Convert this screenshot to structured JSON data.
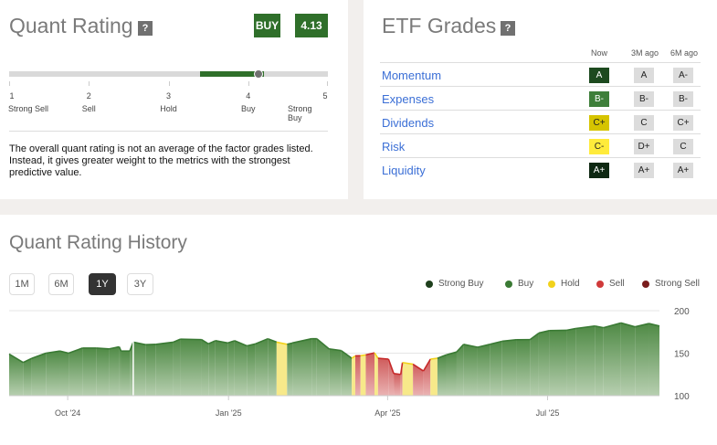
{
  "quant_rating": {
    "title": "Quant Rating",
    "help": "?",
    "rating_label": "BUY",
    "score": "4.13",
    "score_value": 4.13,
    "scale": [
      {
        "num": "1",
        "label": "Strong Sell"
      },
      {
        "num": "2",
        "label": "Sell"
      },
      {
        "num": "3",
        "label": "Hold"
      },
      {
        "num": "4",
        "label": "Buy"
      },
      {
        "num": "5",
        "label": "Strong Buy"
      }
    ],
    "description": "The overall quant rating is not an average of the factor grades listed. Instead, it gives greater weight to the metrics with the strongest predictive value.",
    "accent": "#2f6f2a"
  },
  "etf_grades": {
    "title": "ETF Grades",
    "help": "?",
    "columns": [
      "Now",
      "3M ago",
      "6M ago"
    ],
    "rows": [
      {
        "name": "Momentum",
        "now": "A",
        "m3": "A",
        "m6": "A-",
        "color": "#1d4a1f",
        "text": "#fff"
      },
      {
        "name": "Expenses",
        "now": "B-",
        "m3": "B-",
        "m6": "B-",
        "color": "#3e7f3a",
        "text": "#fff"
      },
      {
        "name": "Dividends",
        "now": "C+",
        "m3": "C",
        "m6": "C+",
        "color": "#d6c400",
        "text": "#222"
      },
      {
        "name": "Risk",
        "now": "C-",
        "m3": "D+",
        "m6": "C",
        "color": "#ffeb3b",
        "text": "#222"
      },
      {
        "name": "Liquidity",
        "now": "A+",
        "m3": "A+",
        "m6": "A+",
        "color": "#0e2812",
        "text": "#fff"
      }
    ]
  },
  "history": {
    "title": "Quant Rating History",
    "ranges": [
      "1M",
      "6M",
      "1Y",
      "3Y"
    ],
    "active_range": "1Y",
    "legend": [
      {
        "label": "Strong Buy",
        "color": "#1e3f1c"
      },
      {
        "label": "Buy",
        "color": "#3a7a34"
      },
      {
        "label": "Hold",
        "color": "#f2d21b"
      },
      {
        "label": "Sell",
        "color": "#d03a3a"
      },
      {
        "label": "Strong Sell",
        "color": "#7a1d1d"
      }
    ]
  },
  "chart_data": {
    "type": "area",
    "xlabel": "",
    "ylabel": "",
    "xlim": [
      0,
      372
    ],
    "ylim": [
      100,
      200
    ],
    "yticks": [
      {
        "v": 100,
        "label": "100"
      },
      {
        "v": 150,
        "label": "150"
      },
      {
        "v": 200,
        "label": "200"
      }
    ],
    "xticks": [
      {
        "v": 33.5,
        "label": "Oct '24"
      },
      {
        "v": 125.5,
        "label": "Jan '25"
      },
      {
        "v": 216.5,
        "label": "Apr '25"
      },
      {
        "v": 308,
        "label": "Jul '25"
      }
    ],
    "gaps": [
      71
    ],
    "points": [
      [
        0,
        149,
        "Buy"
      ],
      [
        8,
        139,
        "Buy"
      ],
      [
        13,
        144,
        "Buy"
      ],
      [
        21,
        150,
        "Buy"
      ],
      [
        29,
        152.5,
        "Buy"
      ],
      [
        34,
        150,
        "Buy"
      ],
      [
        42,
        156,
        "Buy"
      ],
      [
        50,
        156,
        "Buy"
      ],
      [
        57,
        155,
        "Buy"
      ],
      [
        63,
        157.5,
        "Buy"
      ],
      [
        64,
        152.5,
        "Buy"
      ],
      [
        69,
        152.5,
        "Buy"
      ],
      [
        71,
        163,
        "Buy"
      ],
      [
        78,
        160,
        "Buy"
      ],
      [
        84,
        160.4,
        "Buy"
      ],
      [
        94,
        163,
        "Buy"
      ],
      [
        98,
        166.5,
        "Buy"
      ],
      [
        110,
        166,
        "Buy"
      ],
      [
        114,
        161,
        "Buy"
      ],
      [
        118,
        164.7,
        "Buy"
      ],
      [
        125,
        162,
        "Buy"
      ],
      [
        129,
        164.7,
        "Buy"
      ],
      [
        136,
        158.6,
        "Buy"
      ],
      [
        141,
        161,
        "Buy"
      ],
      [
        148,
        167,
        "Buy"
      ],
      [
        153,
        163,
        "Hold"
      ],
      [
        159,
        160.4,
        "Buy"
      ],
      [
        162,
        162,
        "Buy"
      ],
      [
        173,
        167,
        "Buy"
      ],
      [
        176,
        167,
        "Buy"
      ],
      [
        183,
        155,
        "Buy"
      ],
      [
        190,
        153,
        "Buy"
      ],
      [
        196,
        144,
        "Hold"
      ],
      [
        198,
        146.8,
        "Sell"
      ],
      [
        201,
        147,
        "Hold"
      ],
      [
        204,
        148,
        "Sell"
      ],
      [
        209,
        150.4,
        "Hold"
      ],
      [
        211,
        144,
        "Sell"
      ],
      [
        217,
        143,
        "Sell"
      ],
      [
        220,
        126,
        "Sell"
      ],
      [
        224,
        125,
        "Sell"
      ],
      [
        225,
        139,
        "Hold"
      ],
      [
        231,
        137,
        "Sell"
      ],
      [
        237,
        129,
        "Sell"
      ],
      [
        241,
        143,
        "Hold"
      ],
      [
        245,
        144,
        "Buy"
      ],
      [
        250,
        148,
        "Buy"
      ],
      [
        256,
        151.4,
        "Buy"
      ],
      [
        260,
        160.4,
        "Buy"
      ],
      [
        268,
        157,
        "Buy"
      ],
      [
        275,
        160.4,
        "Buy"
      ],
      [
        282,
        164,
        "Buy"
      ],
      [
        290,
        165.8,
        "Buy"
      ],
      [
        298,
        166,
        "Buy"
      ],
      [
        303,
        173.7,
        "Buy"
      ],
      [
        309,
        176.6,
        "Buy"
      ],
      [
        319,
        177,
        "Buy"
      ],
      [
        324,
        179,
        "Buy"
      ],
      [
        335,
        182,
        "Buy"
      ],
      [
        340,
        180,
        "Buy"
      ],
      [
        350,
        185.6,
        "Buy"
      ],
      [
        358,
        181,
        "Buy"
      ],
      [
        366,
        184.9,
        "Buy"
      ],
      [
        372,
        182,
        "Buy"
      ]
    ]
  }
}
